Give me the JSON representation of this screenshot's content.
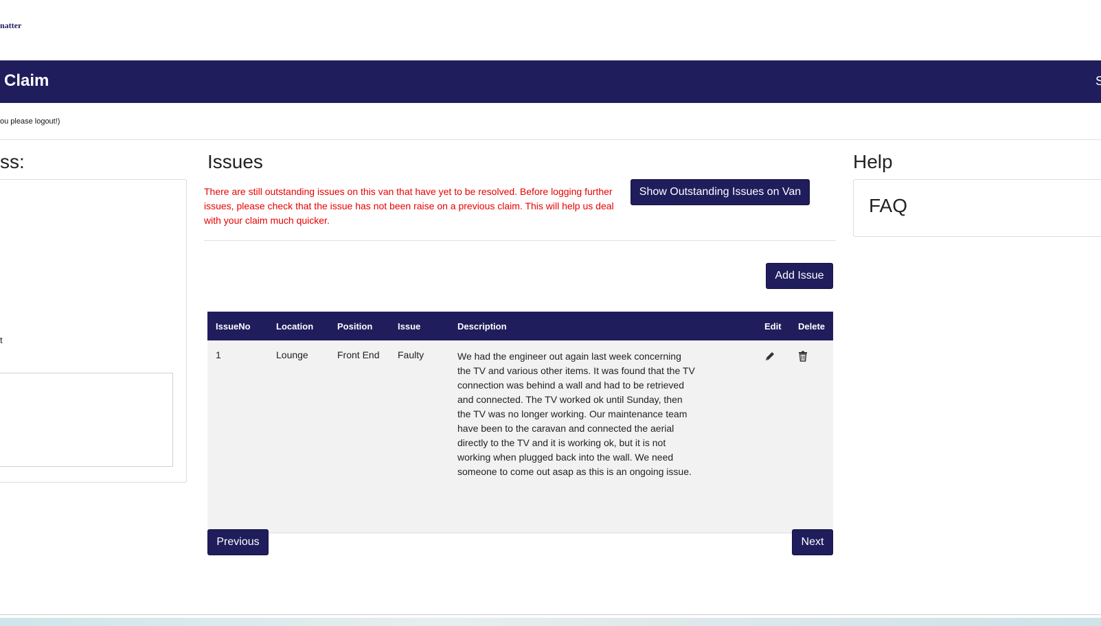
{
  "header": {
    "logo_text": "natter",
    "banner_title": "Claim",
    "banner_right": "S",
    "subnote": "ou please logout!)"
  },
  "left_panel": {
    "heading": "ss:",
    "fragment": "t"
  },
  "issues": {
    "heading": "Issues",
    "warning": "There are still outstanding issues on this van that have yet to be resolved. Before logging further issues, please check that the issue has not been raise on a previous claim. This will help us deal with your claim much quicker.",
    "show_outstanding_label": "Show Outstanding Issues on Van",
    "add_issue_label": "Add Issue",
    "table": {
      "columns": [
        "IssueNo",
        "Location",
        "Position",
        "Issue",
        "Description",
        "Edit",
        "Delete"
      ],
      "rows": [
        {
          "issue_no": "1",
          "location": "Lounge",
          "position": "Front End",
          "issue": "Faulty",
          "description": "We had the engineer out again last week concerning the TV and various other items. It was found that the TV connection was behind a wall and had to be retrieved and connected. The TV worked ok until Sunday, then the TV was no longer working. Our maintenance team have been to the caravan and connected the aerial directly to the TV and it is working ok, but it is not working when plugged back into the wall. We need someone to come out asap as this is an ongoing issue.",
          "edit_icon": "pencil-icon",
          "delete_icon": "trash-icon"
        }
      ]
    },
    "previous_label": "Previous",
    "next_label": "Next"
  },
  "help": {
    "heading": "Help",
    "faq_label": "FAQ"
  },
  "colors": {
    "primary": "#1f1d5c",
    "warning": "#e60000",
    "row_bg": "#f2f2f2"
  }
}
